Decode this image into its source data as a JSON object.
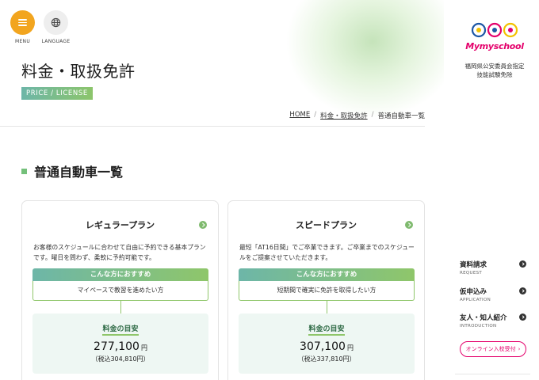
{
  "header": {
    "menu_label": "MENU",
    "language_label": "LANGUAGE",
    "page_title": "料金・取扱免許",
    "badge": "PRICE / LICENSE"
  },
  "logo": {
    "text": "Mymyschool",
    "subtitle_line1": "福岡県公安委員会指定",
    "subtitle_line2": "技能試験免除",
    "colors": {
      "pink": "#e4006b",
      "blue": "#1c57a5",
      "yellow": "#f2c200"
    }
  },
  "breadcrumb": {
    "home": "HOME",
    "parent": "料金・取扱免許",
    "current": "普通自動車一覧",
    "separator": "/"
  },
  "section": {
    "title": "普通自動車一覧"
  },
  "plans": [
    {
      "name": "レギュラープラン",
      "description": "お客様のスケジュールに合わせて自由に予約できる基本プランです。曜日を問わず、柔軟に予約可能です。",
      "recommend_head": "こんな方におすすめ",
      "recommend_body": "マイペースで教習を進めたい方",
      "price_label": "料金の目安",
      "price": "277,100",
      "yen": "円",
      "tax": "（税込304,810円）"
    },
    {
      "name": "スピードプラン",
      "description": "最短「AT16日間」でご卒業できます。ご卒業までのスケジュールをご提案させていただきます。",
      "recommend_head": "こんな方におすすめ",
      "recommend_body": "短期間で確実に免許を取得したい方",
      "price_label": "料金の目安",
      "price": "307,100",
      "yen": "円",
      "tax": "（税込337,810円）"
    }
  ],
  "sidebar": {
    "items": [
      {
        "jp": "資料請求",
        "en": "REQUEST"
      },
      {
        "jp": "仮申込み",
        "en": "APPLICATION"
      },
      {
        "jp": "友人・知人紹介",
        "en": "INTRODUCTION"
      }
    ],
    "online_button": "オンライン入校受付",
    "online_button_arrow": "›"
  },
  "colors": {
    "accent_orange": "#f2a51f",
    "accent_green": "#8fc66a",
    "accent_teal": "#6db6a8",
    "accent_pink": "#e4006b"
  }
}
